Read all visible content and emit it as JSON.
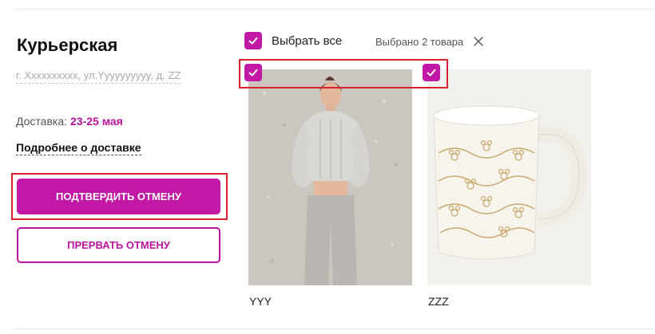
{
  "delivery_block": {
    "title": "Курьерская",
    "address": "г. Xxxxxxxxxx, ул.Yyyyyyyyyy, д. ZZ",
    "delivery_label": "Доставка:",
    "delivery_dates": "23-25 мая",
    "more_link": "Подробнее о доставке"
  },
  "actions": {
    "confirm_label": "ПОДТВЕРДИТЬ ОТМЕНУ",
    "abort_label": "ПРЕРВАТЬ ОТМЕНУ"
  },
  "selection": {
    "select_all_label": "Выбрать все",
    "select_all_checked": true,
    "selected_count": "Выбрано 2 товара"
  },
  "products": [
    {
      "name": "YYY",
      "checked": true,
      "image": "woman-in-grey-knit-set"
    },
    {
      "name": "ZZZ",
      "checked": true,
      "image": "white-mug-with-mouse-pattern"
    }
  ],
  "colors": {
    "accent": "#c218a6",
    "highlight_border": "#d6232b"
  }
}
